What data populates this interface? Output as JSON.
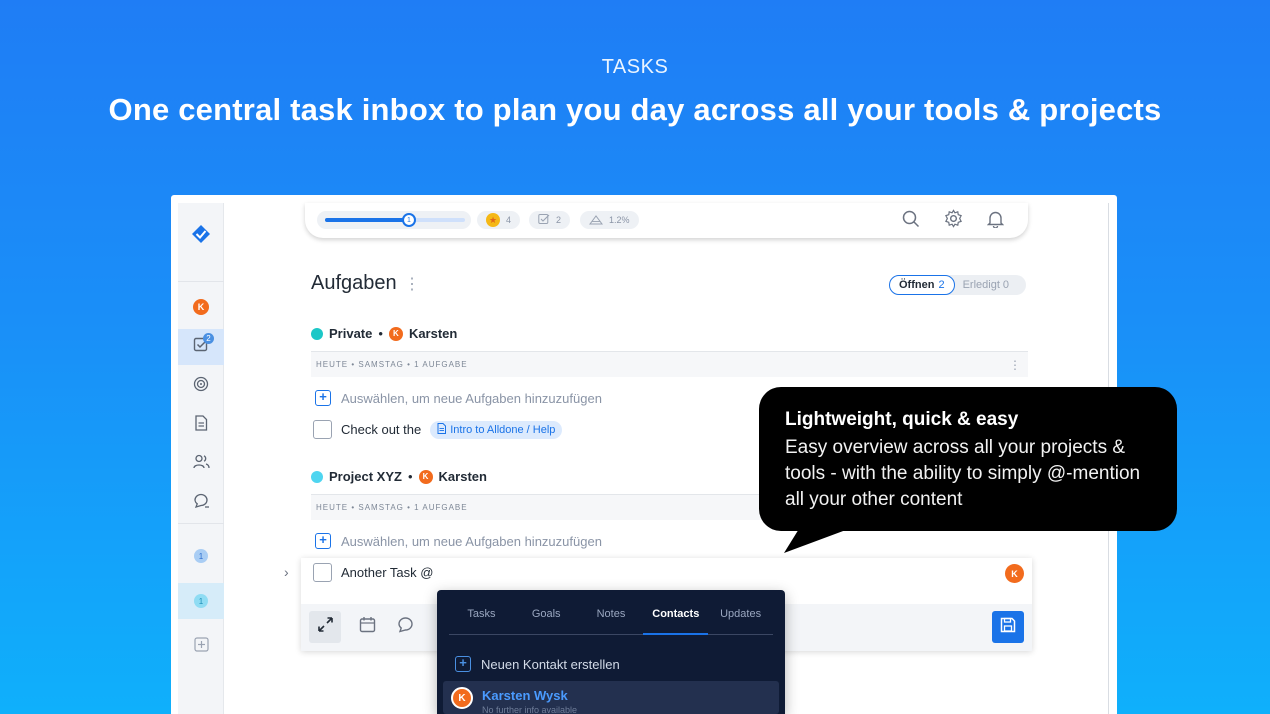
{
  "hero": {
    "tag": "TASKS",
    "title": "One central task inbox to plan you day across all your tools & projects"
  },
  "sidebar": {
    "avatar_letter": "K",
    "tasks_badge": "2",
    "dot1": "1",
    "dot2": "1"
  },
  "topbar": {
    "progress_knob": "1",
    "progress_fraction": 0.6,
    "gold": "4",
    "tasks_done": "2",
    "percent": "1.2%"
  },
  "page": {
    "title": "Aufgaben",
    "menu": "⋮",
    "filter_open_label": "Öffnen",
    "filter_open_count": "2",
    "filter_done_label": "Erledigt 0"
  },
  "groups": [
    {
      "project": "Private",
      "separator": "•",
      "owner": "Karsten",
      "owner_initial": "K",
      "color": "#1cc7c7",
      "day_header": "HEUTE • SAMSTAG • 1 AUFGABE",
      "add_placeholder": "Auswählen, um neue Aufgaben hinzuzufügen",
      "task_text": "Check out the",
      "task_chip": "Intro to Alldone / Help"
    },
    {
      "project": "Project XYZ",
      "separator": "•",
      "owner": "Karsten",
      "owner_initial": "K",
      "color": "#4fd5f0",
      "day_header": "HEUTE • SAMSTAG • 1 AUFGABE",
      "add_placeholder": "Auswählen, um neue Aufgaben hinzuzufügen",
      "task_text": "Another Task @"
    }
  ],
  "editor": {
    "assignee_initial": "K"
  },
  "dropdown": {
    "tabs": [
      "Tasks",
      "Goals",
      "Notes",
      "Contacts",
      "Updates"
    ],
    "active_tab": "Contacts",
    "create_label": "Neuen Kontakt erstellen",
    "contact_name": "Karsten Wysk",
    "contact_initial": "K",
    "contact_sub": "No further info available"
  },
  "callout": {
    "title": "Lightweight, quick & easy",
    "body": "Easy overview across all your projects & tools - with the ability to simply @-mention all your other content"
  },
  "colors": {
    "accent": "#1a73e8",
    "avatar": "#f26b1d"
  }
}
